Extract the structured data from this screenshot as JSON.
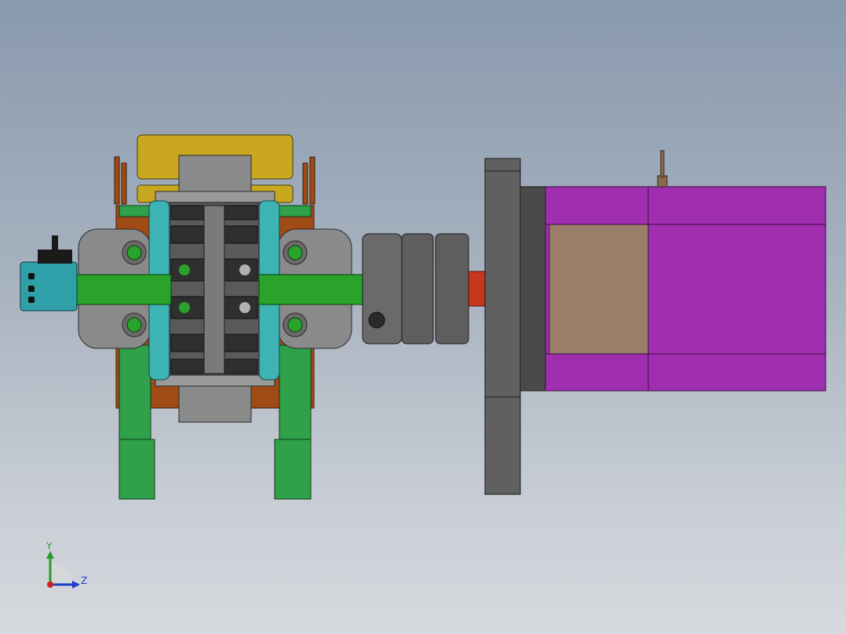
{
  "viewport": {
    "background_top": "#8999ad",
    "background_bottom": "#d6d9de"
  },
  "triad": {
    "y_label": "Y",
    "z_label": "Z",
    "y_color": "#2a9a2a",
    "z_color": "#1f3fc8",
    "x_color": "#c81f1f"
  },
  "model": {
    "colors": {
      "frame_green": "#2ea14a",
      "shaft_green": "#2aa32a",
      "cyan_ring": "#3db3b3",
      "gold_roller": "#c9a820",
      "brown_plate": "#a04a16",
      "steel_gray": "#8a8a8a",
      "dark_gray": "#5a5a5a",
      "motor_purple": "#a02fb0",
      "motor_tan": "#9a7e68",
      "red_shaft": "#c8361e"
    }
  }
}
